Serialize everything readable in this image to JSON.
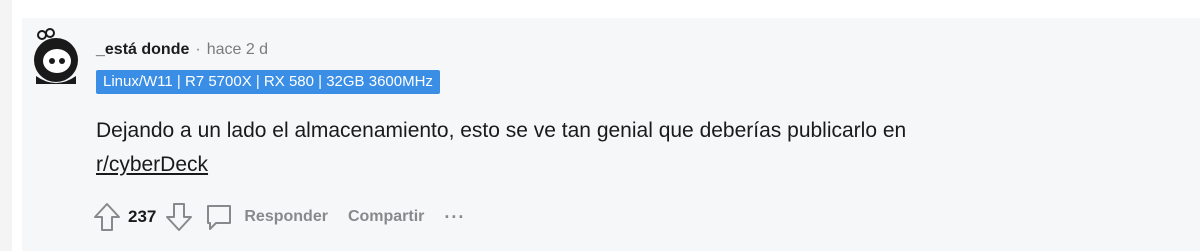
{
  "comment": {
    "author": "_está donde",
    "separator": "·",
    "time": "hace 2 d",
    "flair": "Linux/W11 | R7 5700X | RX 580 | 32GB 3600MHz",
    "body_text": "Dejando a un lado el almacenamiento, esto se ve tan genial que deberías publicarlo en",
    "body_link": "r/cyberDeck",
    "score": "237",
    "reply_label": "Responder",
    "share_label": "Compartir",
    "more_label": "···"
  },
  "colors": {
    "flair_bg": "#3a8ee6",
    "card_bg": "#f6f7f8",
    "muted": "#878a8c"
  },
  "icons": [
    "avatar-snoo",
    "upvote-icon",
    "downvote-icon",
    "comment-icon",
    "more-icon"
  ]
}
